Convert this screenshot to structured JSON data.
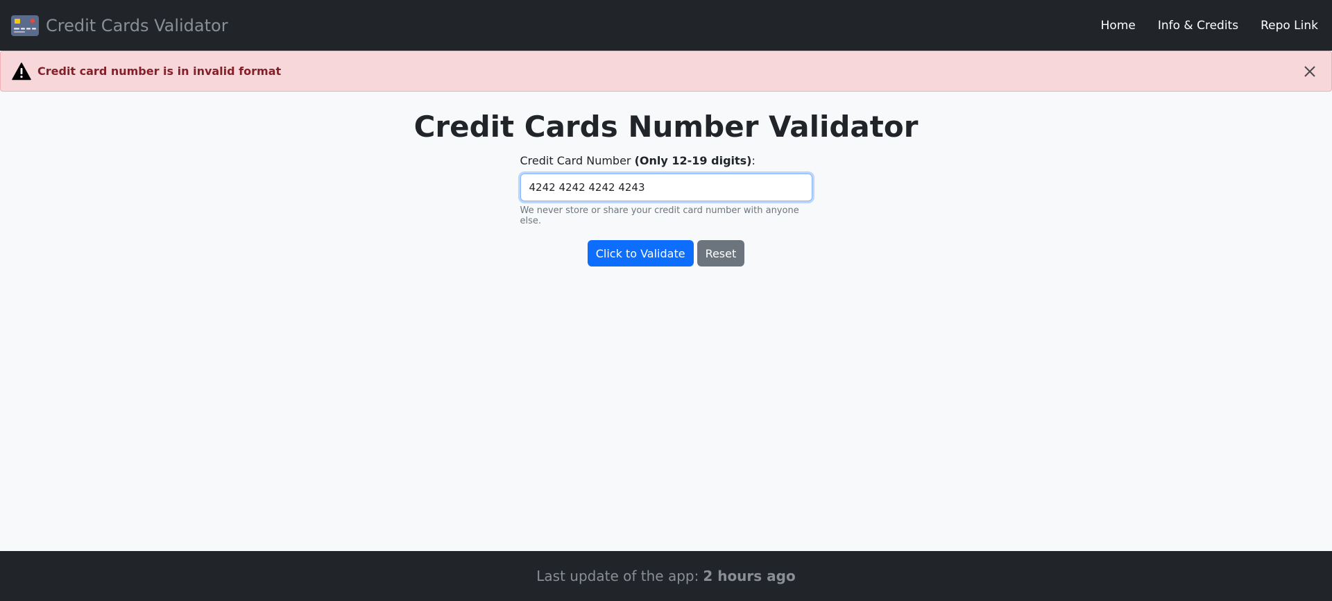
{
  "navbar": {
    "brand": "Credit Cards Validator",
    "brand_icon": "credit-card-icon",
    "links": [
      {
        "label": "Home"
      },
      {
        "label": "Info & Credits"
      },
      {
        "label": "Repo Link"
      }
    ]
  },
  "alert": {
    "message": "Credit card number is in invalid format",
    "icon": "warning-icon",
    "close_icon": "close-icon",
    "bg_color": "#f8d7da",
    "text_color": "#842029"
  },
  "main": {
    "title": "Credit Cards Number Validator",
    "field_label": "Credit Card Number",
    "field_label_bold": "(Only 12-19 digits)",
    "field_label_suffix": ":",
    "input_value": "4242 4242 4242 4243",
    "help_text": "We never store or share your credit card number with anyone else.",
    "validate_label": "Click to Validate",
    "reset_label": "Reset"
  },
  "footer": {
    "prefix": "Last update of the app:",
    "value": "2 hours ago"
  },
  "colors": {
    "navbar_bg": "#212529",
    "primary": "#0d6efd",
    "secondary": "#6c757d",
    "page_bg": "#f8f9fa"
  }
}
